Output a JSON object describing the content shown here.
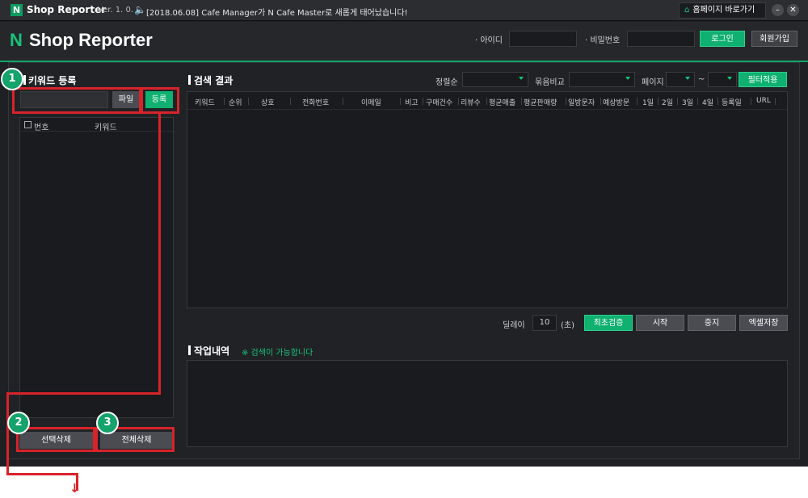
{
  "titlebar": {
    "logo": "N",
    "title": "Shop Reporter",
    "version": "Ver. 1. 0. 1",
    "notice": "[2018.06.08] Cafe Manager가 N Cafe Master로 새롭게 태어났습니다!",
    "home_button": "홈페이지 바로가기",
    "minimize": "–",
    "close": "✕"
  },
  "header": {
    "brand_n": "N",
    "brand_text": " Shop Reporter",
    "id_label": "· 아이디",
    "id_value": "",
    "pw_label": "· 비밀번호",
    "pw_value": "",
    "login_button": "로그인",
    "join_button": "회원가입"
  },
  "keyword_panel": {
    "title": "키워드 등록",
    "input_value": "",
    "file_button": "파일",
    "register_button": "등록",
    "list_headers": [
      "번호",
      "키워드"
    ],
    "delete_selected_button": "선택삭제",
    "delete_all_button": "전체삭제"
  },
  "results_panel": {
    "title": "검색 결과",
    "sort_label": "정렬순",
    "sort_value": "",
    "group_label": "묶음비교",
    "group_value": "",
    "page_label": "페이지",
    "page_from": "",
    "page_sep": "~",
    "page_to": "",
    "filter_button": "필터적용",
    "columns": [
      "키워드",
      "순위",
      "상호",
      "전화번호",
      "이메일",
      "비고",
      "구매건수",
      "리뷰수",
      "평균매출",
      "평균판매량",
      "일방문자",
      "예상방문",
      "1일",
      "2일",
      "3일",
      "4일",
      "등록일",
      "URL"
    ],
    "rows": []
  },
  "controls": {
    "delay_label": "딜레이",
    "delay_value": "10",
    "delay_unit": "(초)",
    "verify_button": "최초검증",
    "start_button": "시작",
    "stop_button": "중지",
    "excel_button": "엑셀저장"
  },
  "log_panel": {
    "title": "작업내역",
    "status": "※ 검색이 가능합니다",
    "entries": []
  },
  "annotations": {
    "badges": [
      "1",
      "2",
      "3"
    ],
    "arrow": "↓"
  },
  "colors": {
    "accent": "#0fb070",
    "highlight": "#d8232a",
    "background": "#1e2024"
  }
}
